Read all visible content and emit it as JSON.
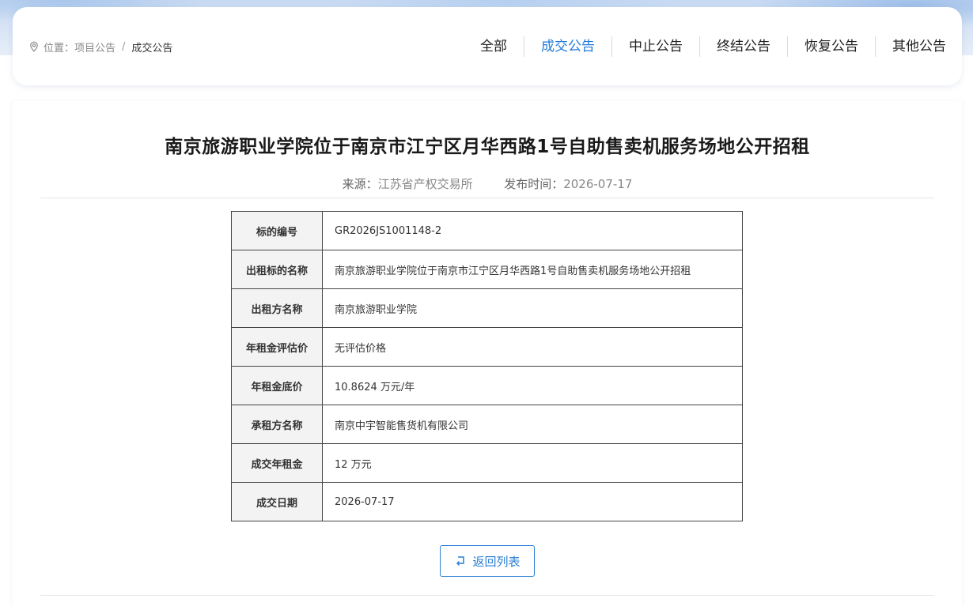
{
  "breadcrumb": {
    "prefix": "位置：",
    "parent": "项目公告",
    "separator": "/",
    "current": "成交公告"
  },
  "tabs": [
    {
      "label": "全部",
      "active": false
    },
    {
      "label": "成交公告",
      "active": true
    },
    {
      "label": "中止公告",
      "active": false
    },
    {
      "label": "终结公告",
      "active": false
    },
    {
      "label": "恢复公告",
      "active": false
    },
    {
      "label": "其他公告",
      "active": false
    }
  ],
  "article": {
    "title": "南京旅游职业学院位于南京市江宁区月华西路1号自助售卖机服务场地公开招租",
    "source_label": "来源：",
    "source": "江苏省产权交易所",
    "date_label": "发布时间：",
    "date": "2026-07-17"
  },
  "table": [
    {
      "key": "标的编号",
      "value": "GR2026JS1001148-2"
    },
    {
      "key": "出租标的名称",
      "value": "南京旅游职业学院位于南京市江宁区月华西路1号自助售卖机服务场地公开招租"
    },
    {
      "key": "出租方名称",
      "value": "南京旅游职业学院"
    },
    {
      "key": "年租金评估价",
      "value": "无评估价格"
    },
    {
      "key": "年租金底价",
      "value": "10.8624 万元/年"
    },
    {
      "key": "承租方名称",
      "value": "南京中宇智能售货机有限公司"
    },
    {
      "key": "成交年租金",
      "value": "12 万元"
    },
    {
      "key": "成交日期",
      "value": "2026-07-17"
    }
  ],
  "back_button": {
    "label": "返回列表",
    "icon": "return-icon"
  },
  "colors": {
    "accent": "#1f7ad8",
    "border": "#444444",
    "key_bg": "#f3f3f3"
  }
}
